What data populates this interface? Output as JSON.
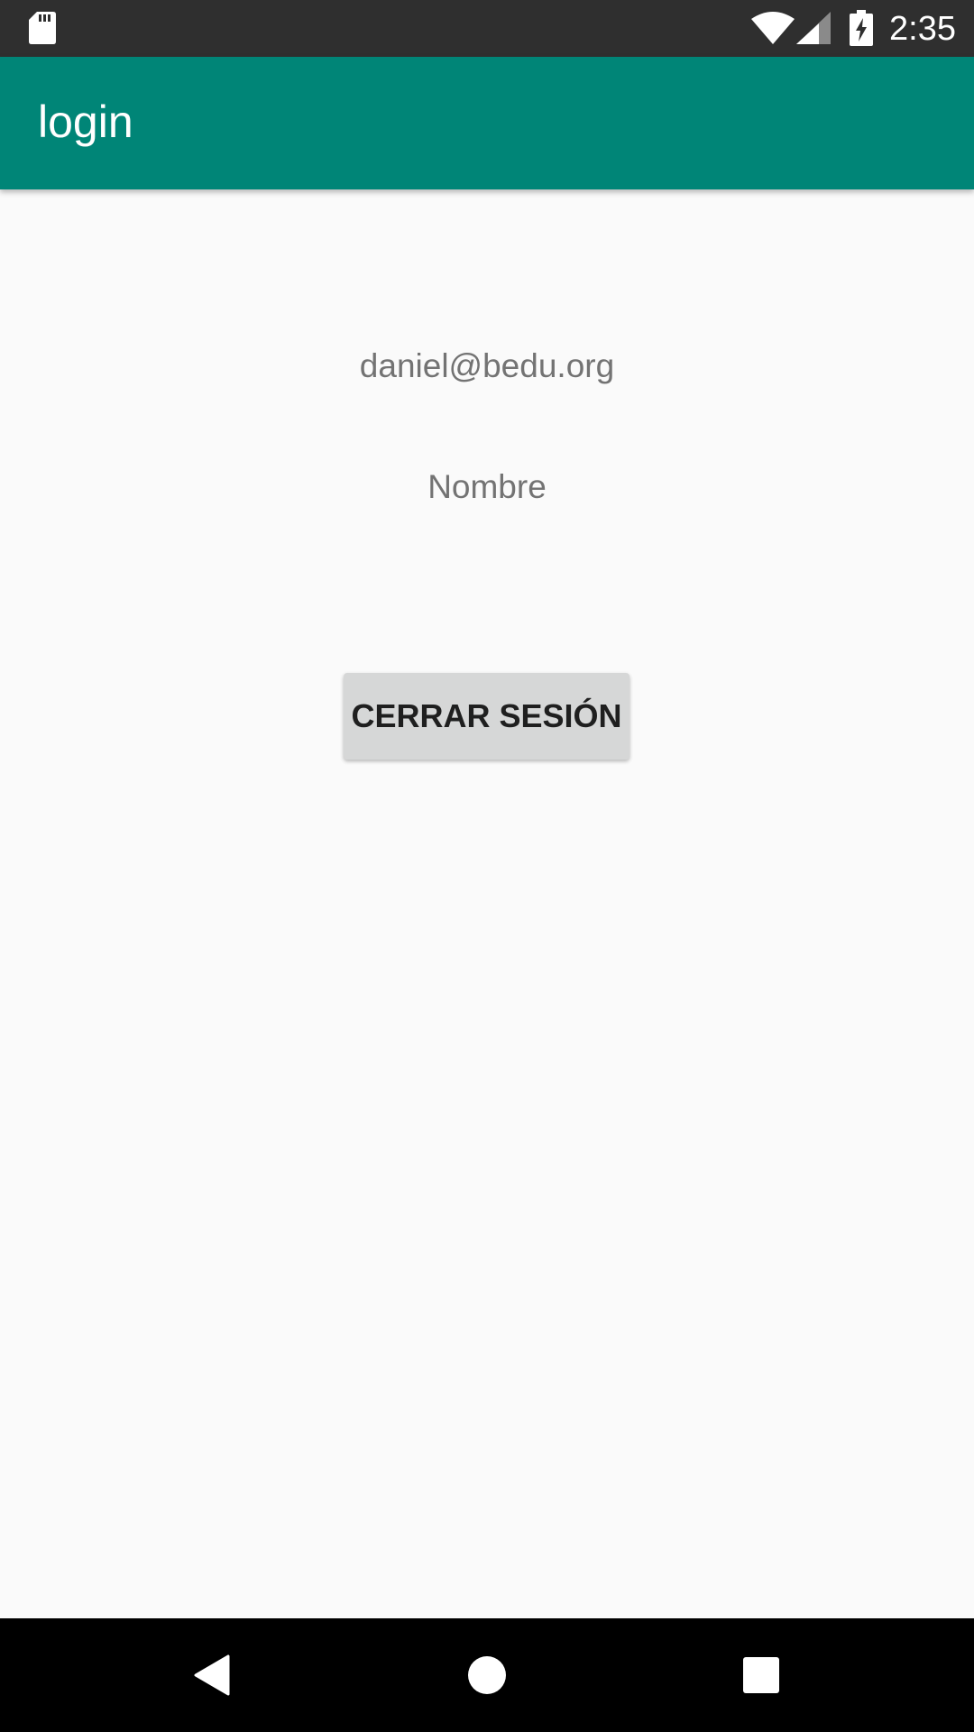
{
  "status_bar": {
    "time": "2:35",
    "icons": [
      "sd-card-icon",
      "wifi-icon",
      "cell-signal-icon",
      "battery-charging-icon"
    ]
  },
  "app_bar": {
    "title": "login",
    "color": "#008577"
  },
  "profile": {
    "email": "daniel@bedu.org",
    "name": "Nombre"
  },
  "actions": {
    "logout_label": "CERRAR SESIÓN"
  },
  "nav_bar": {
    "icons": [
      "back-icon",
      "home-icon",
      "recents-icon"
    ]
  }
}
